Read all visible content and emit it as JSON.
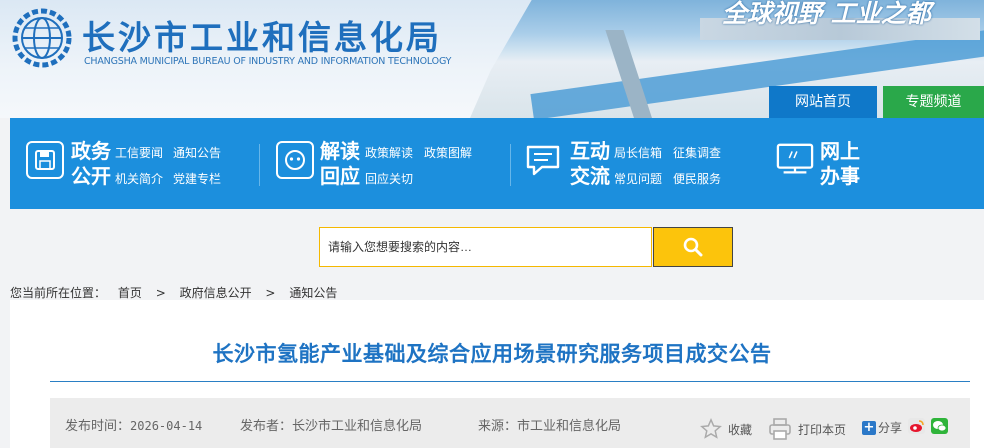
{
  "header": {
    "title": "长沙市工业和信息化局",
    "subtitle_en": "CHANGSHA MUNICIPAL BUREAU OF INDUSTRY AND INFORMATION TECHNOLOGY",
    "slogan": "全球视野 工业之都",
    "tabs": [
      {
        "label": "网站首页"
      },
      {
        "label": "专题频道"
      }
    ]
  },
  "nav": {
    "groups": [
      {
        "icon": "disk-icon",
        "head1": "政务",
        "head2": "公开",
        "links_row1": [
          "工信要闻",
          "通知公告"
        ],
        "links_row2": [
          "机关简介",
          "党建专栏"
        ]
      },
      {
        "icon": "face-icon",
        "head1": "解读",
        "head2": "回应",
        "links_row1": [
          "政策解读",
          "政策图解"
        ],
        "links_row2": [
          "回应关切"
        ]
      },
      {
        "icon": "chat-icon",
        "head1": "互动",
        "head2": "交流",
        "links_row1": [
          "局长信箱",
          "征集调查"
        ],
        "links_row2": [
          "常见问题",
          "便民服务"
        ]
      },
      {
        "icon": "monitor-icon",
        "head1": "网上",
        "head2": "办事"
      }
    ]
  },
  "search": {
    "placeholder": "请输入您想要搜索的内容…"
  },
  "breadcrumb": {
    "prefix": "您当前所在位置：",
    "items": [
      "首页",
      "政府信息公开",
      "通知公告"
    ],
    "separator": ">"
  },
  "article": {
    "title": "长沙市氢能产业基础及综合应用场景研究服务项目成交公告",
    "date_label": "发布时间：",
    "date": "2026-04-14",
    "publisher_label": "发布者：",
    "publisher": "长沙市工业和信息化局",
    "source_label": "来源：",
    "source": "市工业和信息化局",
    "tools": {
      "favorite": "收藏",
      "print": "打印本页",
      "share": "分享"
    }
  },
  "colors": {
    "primary": "#1c8fdd",
    "title_blue": "#1e73c3",
    "search_yellow": "#fcc40c",
    "topic_green": "#2aa84a"
  }
}
